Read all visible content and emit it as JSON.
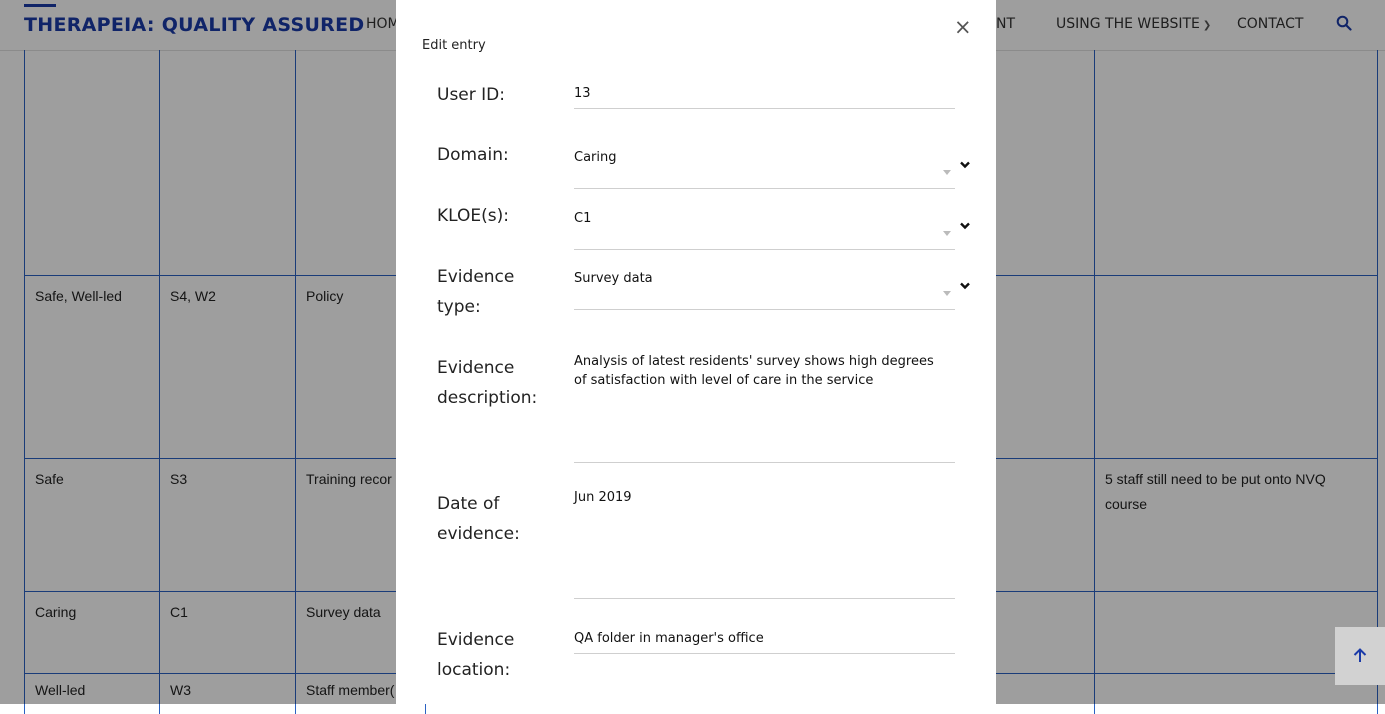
{
  "header": {
    "brand": "THERAPEIA: QUALITY ASSURED",
    "nav": {
      "home_partial": "HOM",
      "ent_partial": "NT",
      "using": "USING THE WEBSITE",
      "contact": "CONTACT"
    }
  },
  "table": {
    "rows": [
      [
        "",
        "",
        "",
        "",
        ""
      ],
      [
        "Safe, Well-led",
        "S4, W2",
        "Policy",
        "",
        ""
      ],
      [
        "Safe",
        "S3",
        "Training recor",
        "",
        "5 staff still need to be put onto NVQ course"
      ],
      [
        "Caring",
        "C1",
        "Survey data",
        "",
        ""
      ],
      [
        "Well-led",
        "W3",
        "Staff member(",
        "",
        ""
      ]
    ]
  },
  "modal": {
    "title": "Edit entry",
    "close": "×",
    "fields": {
      "user_id": {
        "label": "User ID:",
        "value": "13"
      },
      "domain": {
        "label": "Domain:",
        "value": "Caring"
      },
      "kloe": {
        "label": "KLOE(s):",
        "value": "C1"
      },
      "evidence_type": {
        "label": "Evidence type:",
        "value": "Survey data"
      },
      "evidence_description": {
        "label": "Evidence description:",
        "value": "Analysis of latest residents' survey shows high degrees of satisfaction with level of care in the service"
      },
      "date_of_evidence": {
        "label": "Date of evidence:",
        "value": "Jun 2019"
      },
      "evidence_location": {
        "label": "Evidence location:",
        "value": "QA folder in manager's office"
      }
    }
  },
  "colors": {
    "brand": "#1a3aa8",
    "table_border": "#2b62c3",
    "overlay": "rgba(0,0,0,0.38)"
  }
}
